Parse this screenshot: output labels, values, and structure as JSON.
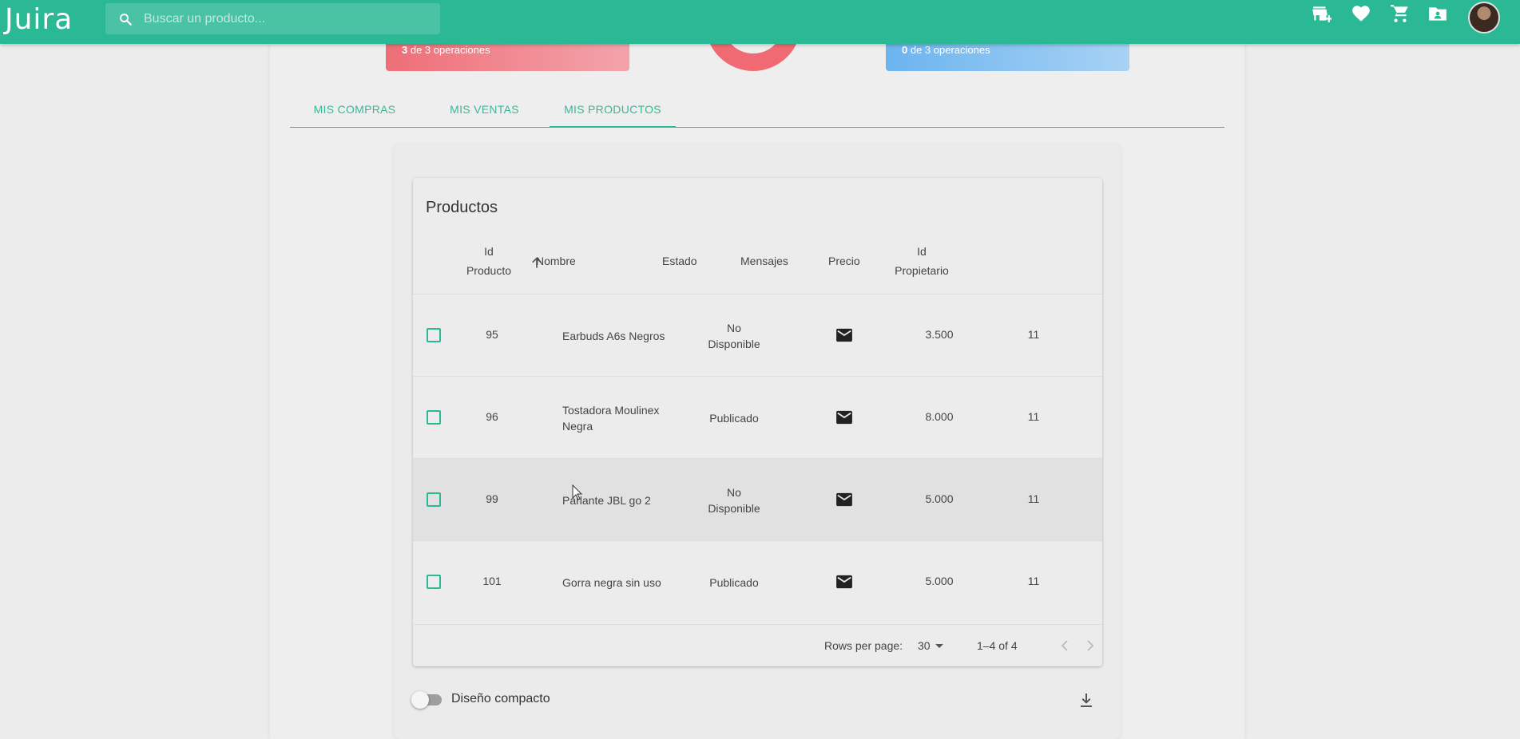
{
  "app": {
    "logo": "Juira"
  },
  "search": {
    "placeholder": "Buscar un producto..."
  },
  "header_icons": [
    "store-add-icon",
    "heart-icon",
    "cart-icon",
    "contacts-icon",
    "avatar"
  ],
  "stats": {
    "left": {
      "count": "3",
      "suffix": " de 3 operaciones",
      "color": "#ee6e77"
    },
    "right": {
      "count": "0",
      "suffix": " de 3 operaciones",
      "color": "#6bb4ef"
    }
  },
  "tabs": [
    {
      "label": "MIS COMPRAS"
    },
    {
      "label": "MIS VENTAS"
    },
    {
      "label": "MIS PRODUCTOS",
      "active": true
    }
  ],
  "table": {
    "title": "Productos",
    "columns": {
      "id_line1": "Id",
      "id_line2": "Producto",
      "nombre": "Nombre",
      "estado": "Estado",
      "mensajes": "Mensajes",
      "precio": "Precio",
      "owner_line1": "Id",
      "owner_line2": "Propietario"
    },
    "rows": [
      {
        "id": "95",
        "nombre_l1": "Earbuds A6s Negros",
        "nombre_l2": "",
        "estado_l1": "No",
        "estado_l2": "Disponible",
        "precio": "3.500",
        "owner": "11"
      },
      {
        "id": "96",
        "nombre_l1": "Tostadora Moulinex",
        "nombre_l2": "Negra",
        "estado_l1": "Publicado",
        "estado_l2": "",
        "precio": "8.000",
        "owner": "11"
      },
      {
        "id": "99",
        "nombre_l1": "Parlante JBL go 2",
        "nombre_l2": "",
        "estado_l1": "No",
        "estado_l2": "Disponible",
        "precio": "5.000",
        "owner": "11"
      },
      {
        "id": "101",
        "nombre_l1": "Gorra negra sin uso",
        "nombre_l2": "",
        "estado_l1": "Publicado",
        "estado_l2": "",
        "precio": "5.000",
        "owner": "11"
      }
    ],
    "footer": {
      "rows_per_page_label": "Rows per page:",
      "rows_per_page": "30",
      "range": "1–4 of 4"
    }
  },
  "compact_toggle": {
    "label": "Diseño compacto",
    "on": false
  },
  "colors": {
    "primary": "#2bb894"
  }
}
